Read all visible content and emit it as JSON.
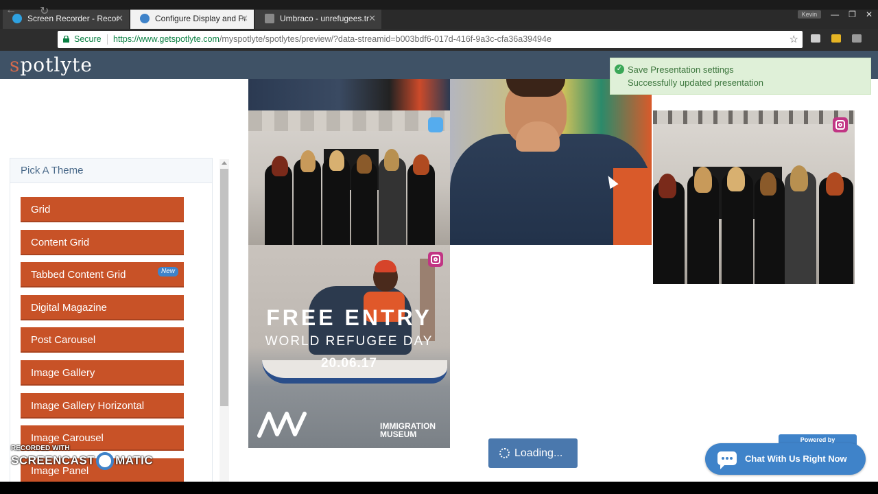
{
  "browser": {
    "tabs": [
      {
        "title": "Screen Recorder - Recor",
        "state": "inactive"
      },
      {
        "title": "Configure Display and Pr",
        "state": "active"
      },
      {
        "title": "Umbraco - unrefugees.tr",
        "state": "inactive"
      }
    ],
    "user_badge": "Kevin",
    "secure_label": "Secure",
    "url_host": "https://www.getspotlyte.com",
    "url_path": "/myspotlyte/spotlytes/preview/?data-streamid=b003bdf6-017d-416f-9a3c-cfa36a39494e",
    "icons": [
      "back-icon",
      "reload-icon",
      "lock-icon",
      "star-icon"
    ]
  },
  "app": {
    "logo_first": "s",
    "logo_rest": "potlyte",
    "brand_color": "#3f5266",
    "accent_color": "#c85227"
  },
  "sidebar": {
    "heading": "Pick A Theme",
    "themes": [
      {
        "label": "Grid"
      },
      {
        "label": "Content Grid"
      },
      {
        "label": "Tabbed Content Grid",
        "badge": "New"
      },
      {
        "label": "Digital Magazine"
      },
      {
        "label": "Post Carousel"
      },
      {
        "label": "Image Gallery"
      },
      {
        "label": "Image Gallery Horizontal"
      },
      {
        "label": "Image Carousel"
      },
      {
        "label": "Image Panel"
      }
    ]
  },
  "preview": {
    "posts": [
      {
        "source": "twitter-icon",
        "content": "group-photo"
      },
      {
        "source": "none",
        "content": "boy-heart-hands-photo"
      },
      {
        "source": "instagram-icon",
        "content": "group-photo"
      },
      {
        "source": "instagram-icon",
        "content": "refugee-day-poster"
      }
    ],
    "poster": {
      "headline": "FREE ENTRY",
      "subheadline": "WORLD REFUGEE DAY",
      "date": "20.06.17",
      "museum_line1": "IMMIGRATION",
      "museum_line2": "MUSEUM"
    }
  },
  "toast": {
    "title": "Save Presentation settings",
    "message": "Successfully updated presentation"
  },
  "loading_label": "Loading...",
  "powered_label": "Powered by",
  "chat_label": "Chat With Us Right Now",
  "watermark": {
    "line1": "RECORDED WITH",
    "brand_left": "SCREENCAST",
    "brand_right": "MATIC"
  }
}
